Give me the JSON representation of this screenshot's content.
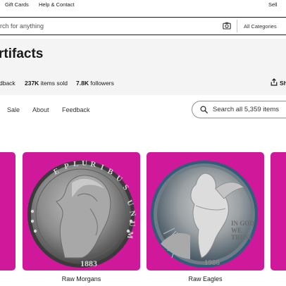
{
  "topbar": {
    "gift_cards": "Gift Cards",
    "help_contact": "Help & Contact",
    "sell": "Sell"
  },
  "search": {
    "placeholder": "rch for anything",
    "category": "All Categories",
    "camera_icon": "camera-icon"
  },
  "store": {
    "title": "rtifacts",
    "feedback_partial": "dback",
    "items_sold_count": "237K",
    "items_sold_label": "items sold",
    "followers_count": "7.8K",
    "followers_label": "followers",
    "share_label": "Sh"
  },
  "nav": {
    "tabs": [
      "Sale",
      "About",
      "Feedback"
    ],
    "store_search_placeholder": "Search all 5,359 items"
  },
  "categories": [
    {
      "label": "Raw Morgans",
      "year": "1883"
    },
    {
      "label": "Raw Eagles",
      "year": "1986"
    }
  ],
  "colors": {
    "card_background": "#d0189a",
    "page_band": "#f4f4f4",
    "text": "#191919"
  }
}
